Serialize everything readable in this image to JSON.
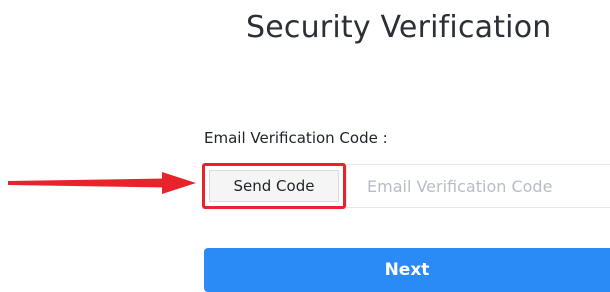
{
  "page": {
    "title": "Security Verification"
  },
  "form": {
    "email_code_label": "Email Verification Code :",
    "send_code_button": "Send Code",
    "email_code_placeholder": "Email Verification Code",
    "email_code_value": "",
    "next_button": "Next"
  },
  "annotation": {
    "arrow_icon": "red-arrow-right-icon",
    "highlight_color": "#e8232b"
  },
  "colors": {
    "primary_button": "#2a8af6",
    "title_text": "#2b2f36",
    "placeholder_text": "#b7bdc6"
  }
}
